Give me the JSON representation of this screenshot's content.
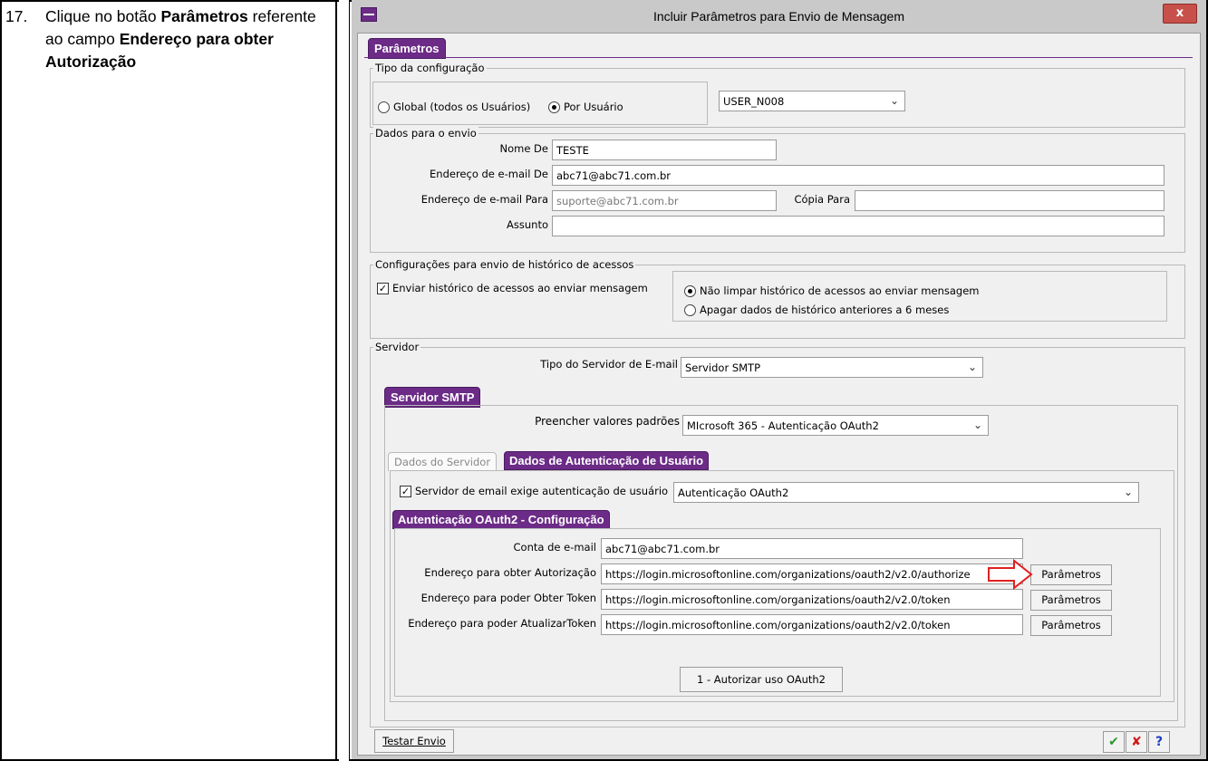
{
  "instruction": {
    "number": "17.",
    "part1": "Clique no botão ",
    "bold1": "Parâmetros",
    "part2": " referente ao campo ",
    "bold2": "Endereço para obter Autorização"
  },
  "window": {
    "title": "Incluir Parâmetros para Envio de Mensagem",
    "close_label": "x"
  },
  "main_tab": "Parâmetros",
  "tipo": {
    "legend": "Tipo da configuração",
    "global_label": "Global (todos os Usuários)",
    "por_usuario_label": "Por Usuário",
    "selected": "por_usuario",
    "user_select": "USER_N008"
  },
  "dados": {
    "legend": "Dados para o envio",
    "nome_de_label": "Nome De",
    "nome_de_value": "TESTE",
    "email_de_label": "Endereço de e-mail De",
    "email_de_value": "abc71@abc71.com.br",
    "email_para_label": "Endereço de e-mail Para",
    "email_para_value": "suporte@abc71.com.br",
    "copia_label": "Cópia Para",
    "copia_value": "",
    "assunto_label": "Assunto",
    "assunto_value": ""
  },
  "historico": {
    "legend": "Configurações para envio de histórico de acessos",
    "enviar_label": "Enviar histórico de acessos ao enviar mensagem",
    "enviar_checked": true,
    "nao_limpar_label": "Não limpar histórico de acessos ao enviar mensagem",
    "apagar_label": "Apagar dados de histórico anteriores a 6 meses",
    "selected": "nao_limpar"
  },
  "servidor": {
    "legend": "Servidor",
    "tipo_label": "Tipo do Servidor de E-mail",
    "tipo_value": "Servidor SMTP",
    "smtp_tab": "Servidor SMTP",
    "preencher_label": "Preencher valores padrões",
    "preencher_value": "MIcrosoft 365 - Autenticação OAuth2",
    "tab_dados_servidor": "Dados do Servidor",
    "tab_dados_auth": "Dados de Autenticação de Usuário",
    "exige_auth_label": "Servidor de email exige autenticação de usuário",
    "exige_auth_checked": true,
    "auth_type_value": "Autenticação OAuth2",
    "oauth_tab": "Autenticação OAuth2 - Configuração",
    "conta_label": "Conta de e-mail",
    "conta_value": "abc71@abc71.com.br",
    "autorizacao_label": "Endereço para obter Autorização",
    "autorizacao_value": "https://login.microsoftonline.com/organizations/oauth2/v2.0/authorize",
    "token_label": "Endereço para poder Obter Token",
    "token_value": "https://login.microsoftonline.com/organizations/oauth2/v2.0/token",
    "atualizar_label": "Endereço para poder AtualizarToken",
    "atualizar_value": "https://login.microsoftonline.com/organizations/oauth2/v2.0/token",
    "parametros_label": "Parâmetros",
    "autorizar_label": "1 - Autorizar uso OAuth2"
  },
  "footer": {
    "testar_label": "Testar Envio",
    "ok_icon": "check-icon",
    "cancel_icon": "x-icon",
    "help_icon": "question-icon"
  },
  "colors": {
    "accent": "#6b2b86",
    "arrow": "#e02020"
  }
}
